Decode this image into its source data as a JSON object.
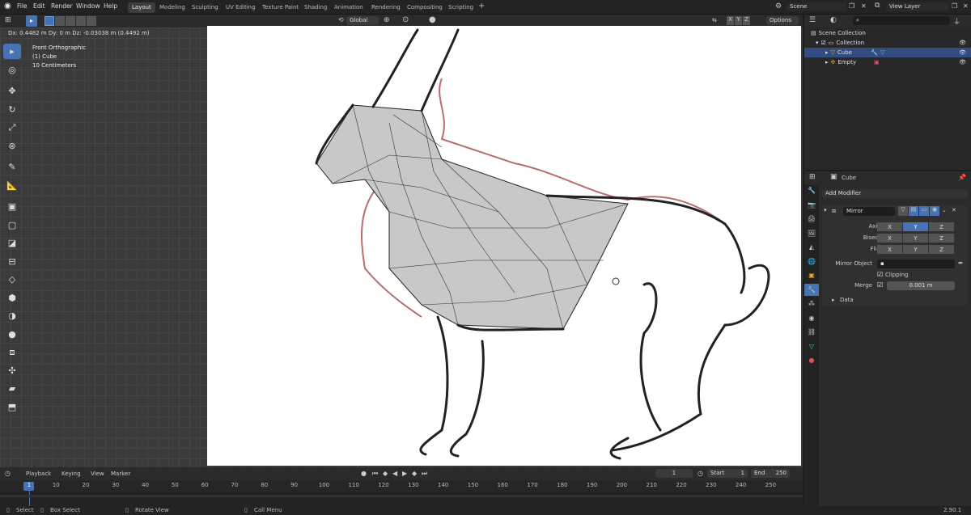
{
  "menus": [
    "File",
    "Edit",
    "Render",
    "Window",
    "Help"
  ],
  "workspaces": [
    "Layout",
    "Modeling",
    "Sculpting",
    "UV Editing",
    "Texture Paint",
    "Shading",
    "Animation",
    "Rendering",
    "Compositing",
    "Scripting"
  ],
  "scene": "Scene",
  "view_layer": "View Layer",
  "header": {
    "orientation": "Global",
    "options": "Options",
    "axes": [
      "X",
      "Y",
      "Z"
    ]
  },
  "operator_info": "Dx: 0.4482 m  Dy: 0 m  Dz: -0.03038 m (0.4492 m)",
  "viewport_overlay": {
    "view": "Front Orthographic",
    "object": "(1) Cube",
    "scale": "10 Centimeters"
  },
  "outliner": {
    "root": "Scene Collection",
    "collection": "Collection",
    "items": [
      "Cube",
      "Empty"
    ]
  },
  "properties": {
    "object_name": "Cube",
    "add_modifier": "Add Modifier",
    "modifier_name": "Mirror",
    "rows": [
      {
        "label": "Axis",
        "x": "X",
        "y": "Y",
        "z": "Z",
        "active": "Y"
      },
      {
        "label": "Bisect",
        "x": "X",
        "y": "Y",
        "z": "Z",
        "active": ""
      },
      {
        "label": "Flip",
        "x": "X",
        "y": "Y",
        "z": "Z",
        "active": ""
      }
    ],
    "mirror_object_label": "Mirror Object",
    "clipping": "Clipping",
    "merge_label": "Merge",
    "merge_value": "0.001 m",
    "data_panel": "Data"
  },
  "timeline": {
    "menus": [
      "Playback",
      "Keying",
      "View",
      "Marker"
    ],
    "current_frame": "1",
    "start_label": "Start",
    "start": "1",
    "end_label": "End",
    "end": "250",
    "ticks": [
      "1",
      "10",
      "20",
      "30",
      "40",
      "50",
      "60",
      "70",
      "80",
      "90",
      "100",
      "110",
      "120",
      "130",
      "140",
      "150",
      "160",
      "170",
      "180",
      "190",
      "200",
      "210",
      "220",
      "230",
      "240",
      "250"
    ]
  },
  "statusbar": {
    "select": "Select",
    "box_select": "Box Select",
    "rotate": "Rotate View",
    "call_menu": "Call Menu",
    "version": "2.90.1"
  },
  "colors": {
    "accent": "#4772b3",
    "selected_row": "#334d80",
    "background": "#1d1d1d",
    "viewport_grid": "#3a3a3a",
    "sketch_red": "#a84848"
  }
}
